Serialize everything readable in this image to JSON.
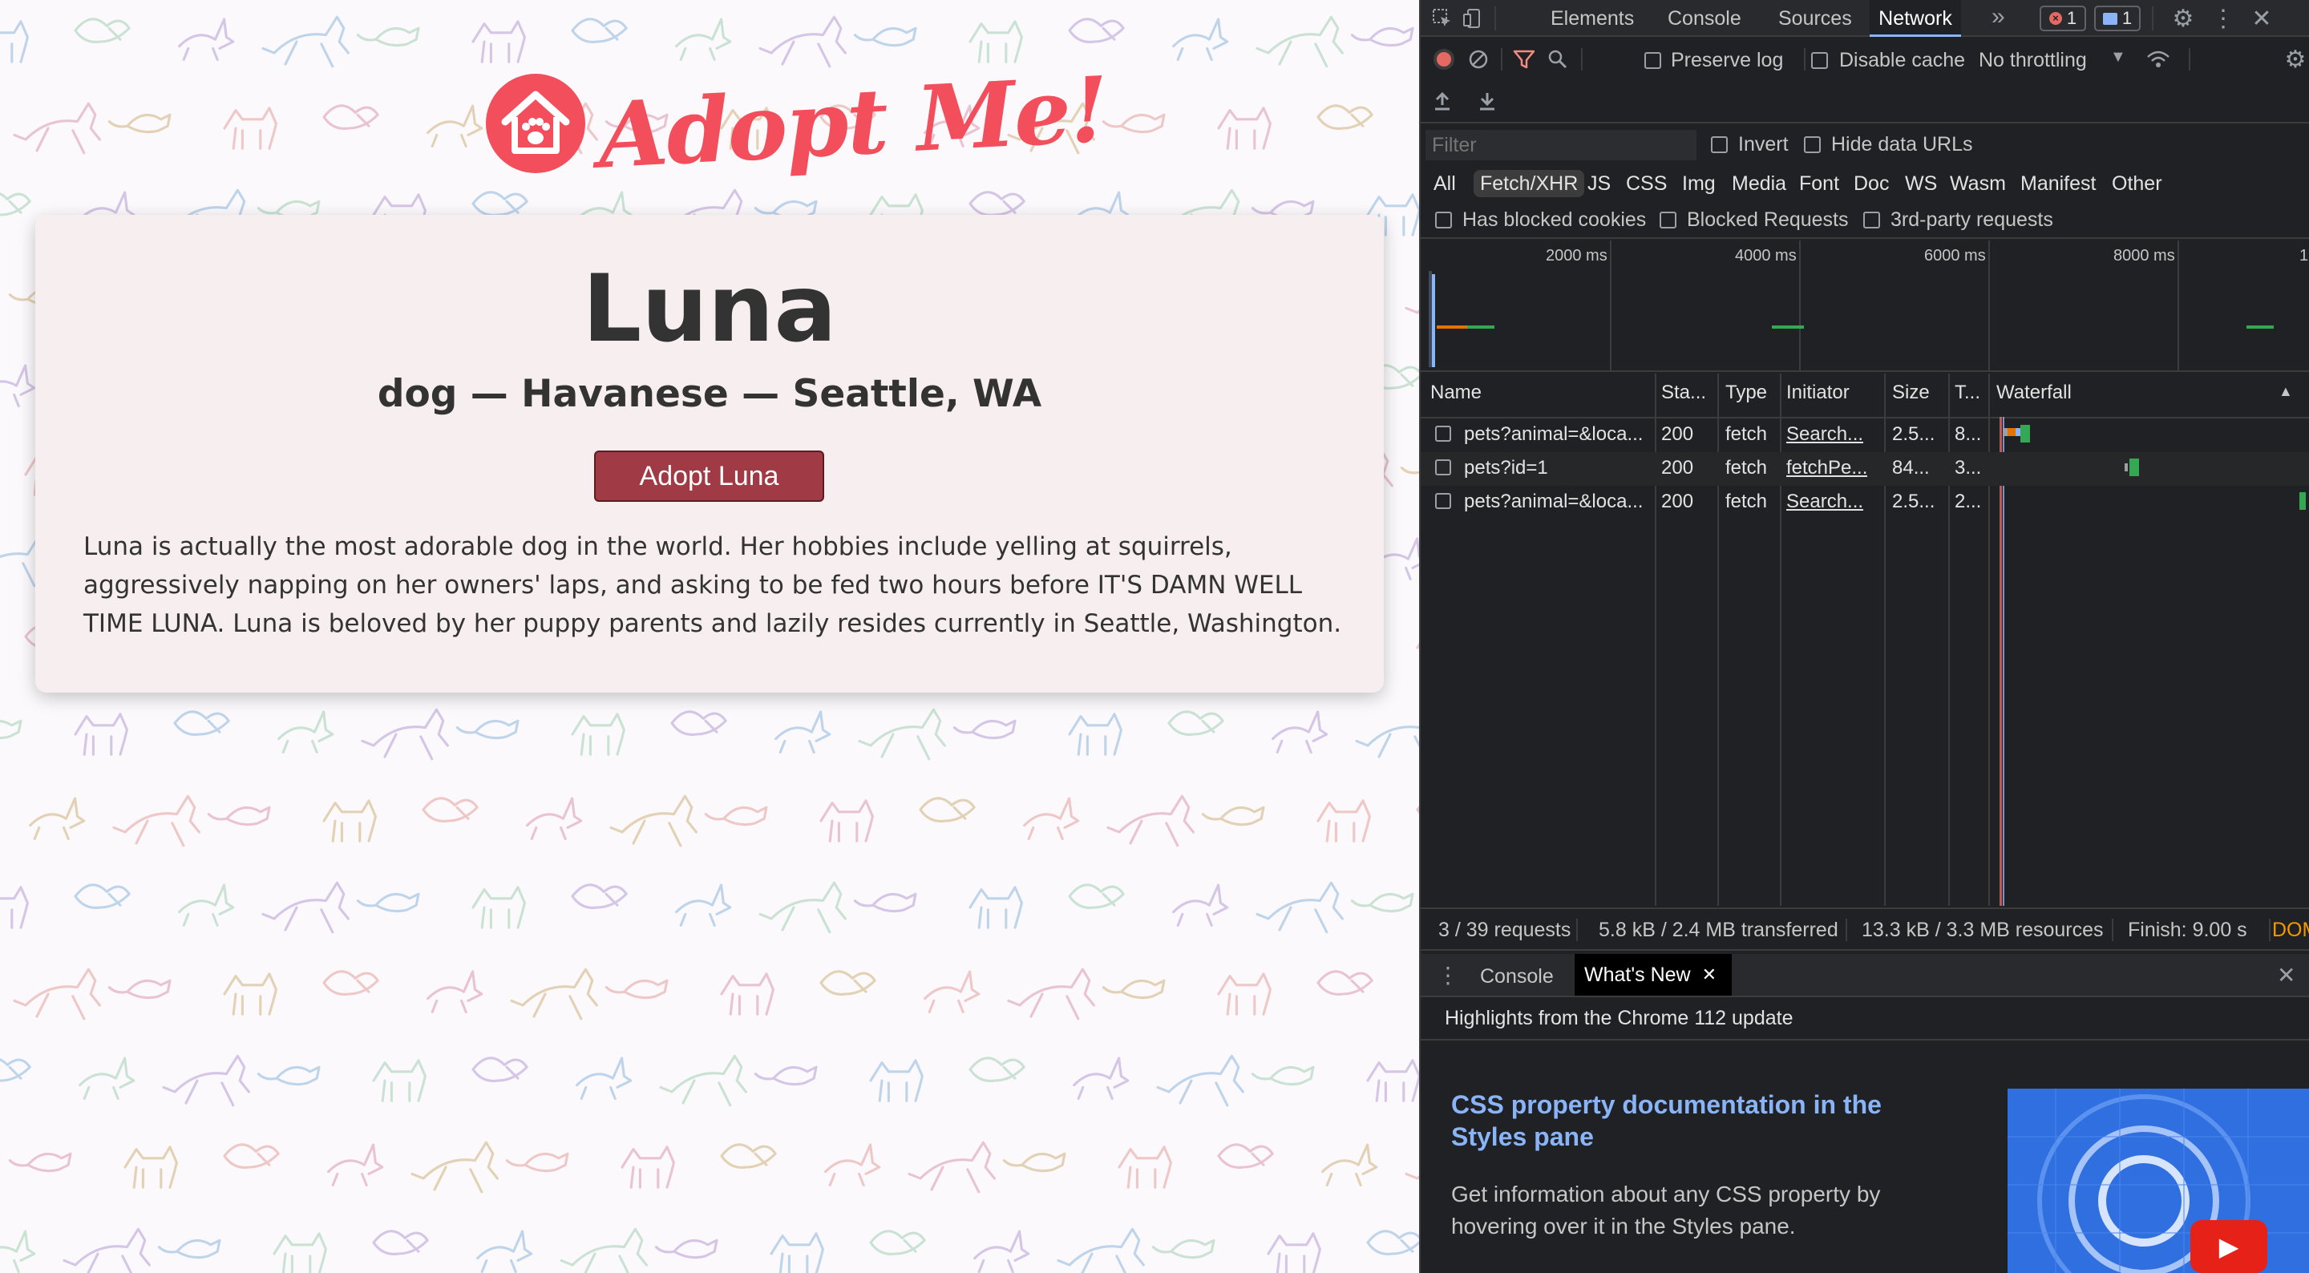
{
  "page": {
    "logo_text": "Adopt Me!",
    "pet": {
      "name": "Luna",
      "subtitle": "dog — Havanese — Seattle, WA",
      "adopt_button": "Adopt Luna",
      "description": "Luna is actually the most adorable dog in the world. Her hobbies include yelling at squirrels, aggressively napping on her owners' laps, and asking to be fed two hours before IT'S DAMN WELL TIME LUNA. Luna is beloved by her puppy parents and lazily resides currently in Seattle, Washington."
    }
  },
  "devtools": {
    "tabs": [
      "Elements",
      "Console",
      "Sources",
      "Network"
    ],
    "active_tab": "Network",
    "error_count": "1",
    "message_count": "1",
    "toolbar": {
      "preserve_log": "Preserve log",
      "disable_cache": "Disable cache",
      "throttling": "No throttling"
    },
    "filter": {
      "placeholder": "Filter",
      "invert": "Invert",
      "hide_data_urls": "Hide data URLs",
      "types": [
        "All",
        "Fetch/XHR",
        "JS",
        "CSS",
        "Img",
        "Media",
        "Font",
        "Doc",
        "WS",
        "Wasm",
        "Manifest",
        "Other"
      ],
      "active_type": "Fetch/XHR",
      "has_blocked_cookies": "Has blocked cookies",
      "blocked_requests": "Blocked Requests",
      "third_party": "3rd-party requests"
    },
    "overview_ticks": [
      "2000 ms",
      "4000 ms",
      "6000 ms",
      "8000 ms",
      "1"
    ],
    "table": {
      "columns": [
        "Name",
        "Sta...",
        "Type",
        "Initiator",
        "Size",
        "T...",
        "Waterfall"
      ],
      "rows": [
        {
          "name": "pets?animal=&loca...",
          "status": "200",
          "type": "fetch",
          "initiator": "Search...",
          "size": "2.5...",
          "time": "8..."
        },
        {
          "name": "pets?id=1",
          "status": "200",
          "type": "fetch",
          "initiator": "fetchPe...",
          "size": "84...",
          "time": "3..."
        },
        {
          "name": "pets?animal=&loca...",
          "status": "200",
          "type": "fetch",
          "initiator": "Search...",
          "size": "2.5...",
          "time": "2..."
        }
      ]
    },
    "status_bar": {
      "requests": "3 / 39 requests",
      "transferred": "5.8 kB / 2.4 MB transferred",
      "resources": "13.3 kB / 3.3 MB resources",
      "finish": "Finish: 9.00 s",
      "dom": "DOM"
    },
    "drawer": {
      "tabs": [
        "Console",
        "What's New"
      ],
      "active_tab": "What's New",
      "highlight": "Highlights from the Chrome 112 update",
      "article_title": "CSS property documentation in the Styles pane",
      "article_body": "Get information about any CSS property by hovering over it in the Styles pane."
    },
    "colors": {
      "accent": "#f24e5c",
      "active_filter_bg": "#3c3c3c",
      "link": "#8ab4f8"
    }
  }
}
